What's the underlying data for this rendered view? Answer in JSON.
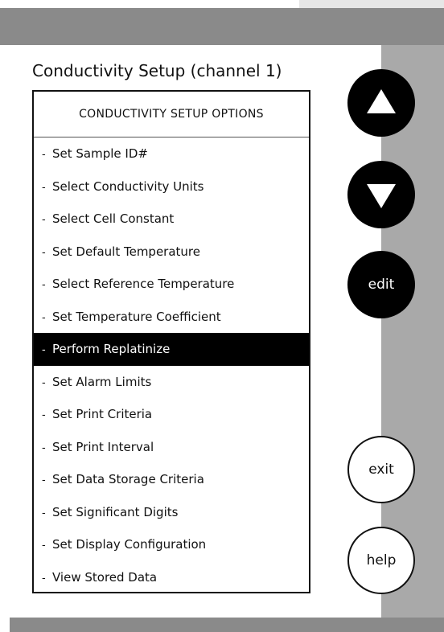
{
  "screen": {
    "title": "Conductivity Setup (channel 1)"
  },
  "menu": {
    "header": "CONDUCTIVITY SETUP OPTIONS",
    "item_prefix": "-",
    "selected_index": 6,
    "items": [
      {
        "label": "Set Sample ID#"
      },
      {
        "label": "Select Conductivity Units"
      },
      {
        "label": "Select Cell Constant"
      },
      {
        "label": "Set Default Temperature"
      },
      {
        "label": "Select Reference Temperature"
      },
      {
        "label": "Set Temperature Coefficient"
      },
      {
        "label": "Perform Replatinize"
      },
      {
        "label": "Set Alarm Limits"
      },
      {
        "label": "Set Print Criteria"
      },
      {
        "label": "Set Print Interval"
      },
      {
        "label": "Set Data Storage Criteria"
      },
      {
        "label": "Set Significant Digits"
      },
      {
        "label": "Set Display Configuration"
      },
      {
        "label": "View Stored Data"
      }
    ]
  },
  "buttons": {
    "up_icon": "up-arrow-icon",
    "down_icon": "down-arrow-icon",
    "edit_label": "edit",
    "exit_label": "exit",
    "help_label": "help"
  },
  "colors": {
    "selected_background": "#000000",
    "selected_text": "#ffffff",
    "frame_gray": "#8a8a8a",
    "rail_gray": "#a9a9a9"
  }
}
